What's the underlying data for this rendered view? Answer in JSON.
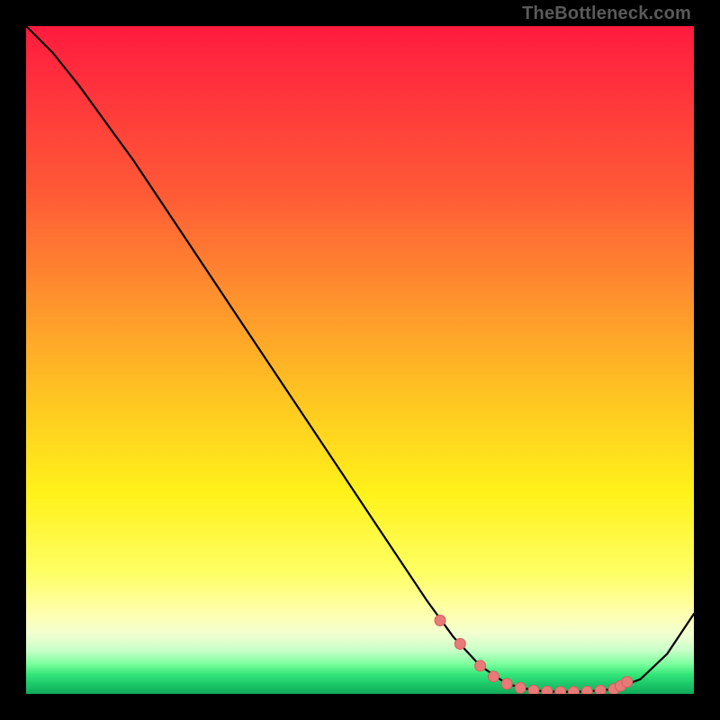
{
  "watermark": "TheBottleneck.com",
  "colors": {
    "curve": "#000000",
    "marker_fill": "#e87a78",
    "marker_stroke": "#d45f5d",
    "background_black": "#000000"
  },
  "chart_data": {
    "type": "line",
    "title": "",
    "xlabel": "",
    "ylabel": "",
    "xlim": [
      0,
      100
    ],
    "ylim": [
      0,
      100
    ],
    "grid": false,
    "series": [
      {
        "name": "bottleneck-curve",
        "x": [
          0,
          4,
          8,
          12,
          16,
          20,
          24,
          28,
          32,
          36,
          40,
          44,
          48,
          52,
          56,
          60,
          64,
          68,
          72,
          76,
          80,
          84,
          88,
          92,
          96,
          100
        ],
        "values": [
          100,
          96,
          91,
          85.5,
          80,
          74,
          68,
          62,
          56,
          50,
          44,
          38,
          32,
          26,
          20,
          14,
          8.5,
          4.2,
          1.5,
          0.5,
          0.3,
          0.35,
          0.7,
          2.2,
          6,
          12
        ]
      }
    ],
    "markers": {
      "name": "highlighted-points",
      "x": [
        62,
        65,
        68,
        70,
        72,
        74,
        76,
        78,
        80,
        82,
        84,
        86,
        88,
        89,
        90
      ],
      "values": [
        11,
        7.5,
        4.2,
        2.6,
        1.5,
        0.9,
        0.5,
        0.35,
        0.3,
        0.3,
        0.35,
        0.5,
        0.7,
        1.2,
        1.8
      ]
    }
  }
}
